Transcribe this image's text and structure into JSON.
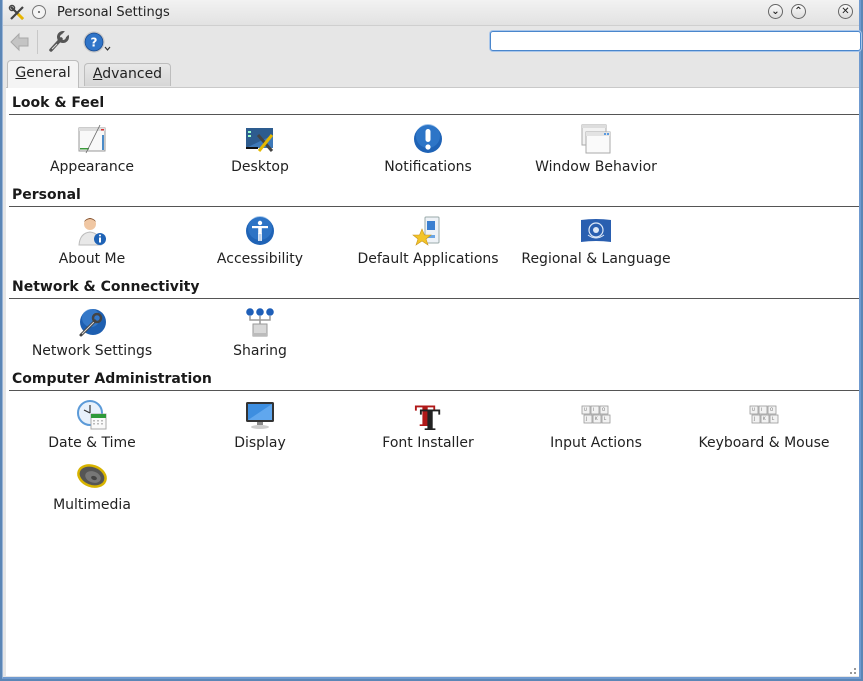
{
  "window": {
    "title": "Personal Settings",
    "buttons": {
      "minimize": "⌄",
      "maximize": "⌃",
      "close": "✕"
    }
  },
  "toolbar": {
    "back_icon": "back-arrow-icon",
    "configure_icon": "wrench-icon",
    "help_icon": "help-icon",
    "search": {
      "value": "",
      "placeholder": ""
    }
  },
  "tabs": [
    {
      "label_prefix": "",
      "label_underline": "G",
      "label_rest": "eneral",
      "active": true
    },
    {
      "label_prefix": "",
      "label_underline": "A",
      "label_rest": "dvanced",
      "active": false
    }
  ],
  "sections": [
    {
      "title": "Look & Feel",
      "items": [
        {
          "label": "Appearance",
          "icon": "appearance-icon"
        },
        {
          "label": "Desktop",
          "icon": "desktop-icon"
        },
        {
          "label": "Notifications",
          "icon": "notifications-icon"
        },
        {
          "label": "Window Behavior",
          "icon": "window-behavior-icon"
        }
      ]
    },
    {
      "title": "Personal",
      "items": [
        {
          "label": "About Me",
          "icon": "about-me-icon"
        },
        {
          "label": "Accessibility",
          "icon": "accessibility-icon"
        },
        {
          "label": "Default Applications",
          "icon": "default-applications-icon"
        },
        {
          "label": "Regional & Language",
          "icon": "regional-language-icon"
        }
      ]
    },
    {
      "title": "Network & Connectivity",
      "items": [
        {
          "label": "Network Settings",
          "icon": "network-settings-icon"
        },
        {
          "label": "Sharing",
          "icon": "sharing-icon"
        }
      ]
    },
    {
      "title": "Computer Administration",
      "items": [
        {
          "label": "Date & Time",
          "icon": "date-time-icon"
        },
        {
          "label": "Display",
          "icon": "display-icon"
        },
        {
          "label": "Font Installer",
          "icon": "font-installer-icon"
        },
        {
          "label": "Input Actions",
          "icon": "input-actions-icon"
        },
        {
          "label": "Keyboard & Mouse",
          "icon": "keyboard-mouse-icon"
        },
        {
          "label": "Multimedia",
          "icon": "multimedia-icon"
        }
      ]
    }
  ]
}
